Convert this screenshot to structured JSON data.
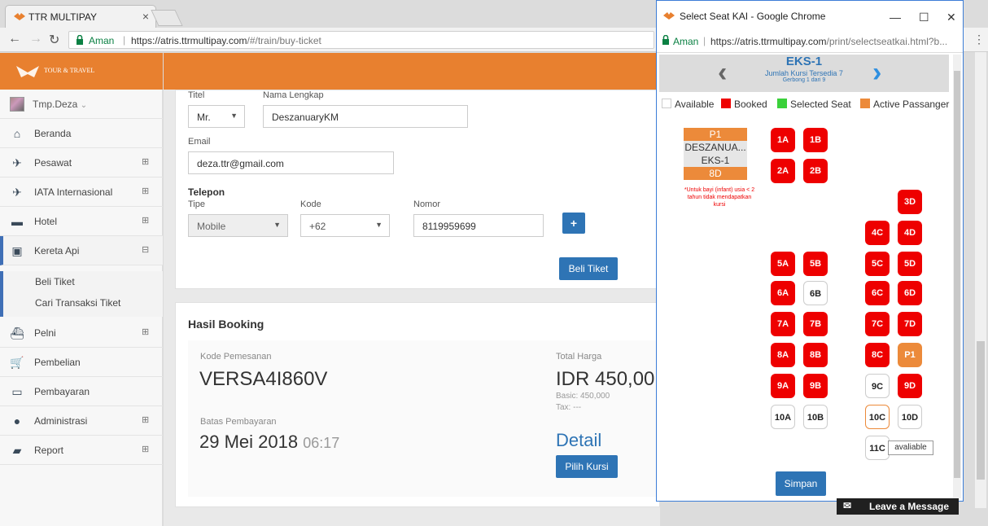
{
  "browser": {
    "tab_title": "TTR MULTIPAY",
    "tab_close": "×",
    "secure_label": "Aman",
    "url_host": "https://atris.ttrmultipay.com",
    "url_path": "/#/train/buy-ticket"
  },
  "sidebar": {
    "logo_text": "TOUR & TRAVEL",
    "user_name": "Tmp.Deza",
    "items": [
      {
        "label": "Beranda",
        "icon": "home-icon"
      },
      {
        "label": "Pesawat",
        "icon": "plane-icon"
      },
      {
        "label": "IATA Internasional",
        "icon": "plane-icon"
      },
      {
        "label": "Hotel",
        "icon": "bed-icon"
      },
      {
        "label": "Kereta Api",
        "icon": "train-icon"
      },
      {
        "label": "Pelni",
        "icon": "ship-icon"
      },
      {
        "label": "Pembelian",
        "icon": "cart-icon"
      },
      {
        "label": "Pembayaran",
        "icon": "money-icon"
      },
      {
        "label": "Administrasi",
        "icon": "user-icon"
      },
      {
        "label": "Report",
        "icon": "folder-icon"
      }
    ],
    "subitems": [
      "Beli Tiket",
      "Cari Transaksi Tiket"
    ]
  },
  "form": {
    "titel_label": "Titel",
    "titel_value": "Mr.",
    "nama_label": "Nama Lengkap",
    "nama_value": "DeszanuaryKM",
    "email_label": "Email",
    "email_value": "deza.ttr@gmail.com",
    "telepon_label": "Telepon",
    "tipe_label": "Tipe",
    "tipe_value": "Mobile",
    "kode_label": "Kode",
    "kode_value": "+62",
    "nomor_label": "Nomor",
    "nomor_value": "8119959699",
    "add_label": "+",
    "beli_label": "Beli Tiket"
  },
  "booking": {
    "heading": "Hasil Booking",
    "kode_label": "Kode Pemesanan",
    "kode_value": "VERSA4I860V",
    "total_label": "Total Harga",
    "total_value": "IDR 450,00",
    "basic": "Basic: 450,000",
    "tax": "Tax: ---",
    "batas_label": "Batas Pembayaran",
    "batas_date": "29 Mei 2018",
    "batas_time": "06:17",
    "detail": "Detail",
    "pilih_label": "Pilih Kursi"
  },
  "popup": {
    "window_title": "Select Seat KAI - Google Chrome",
    "secure_label": "Aman",
    "url_host": "https://atris.ttrmultipay.com",
    "url_path": "/print/selectseatkai.html?b...",
    "coach": "EKS-1",
    "jumlah": "Jumlah Kursi Tersedia 7",
    "gerbong": "Gerbong 1 dari 9",
    "legend": [
      {
        "label": "Available",
        "color": "#ffffff"
      },
      {
        "label": "Booked",
        "color": "#ee0000"
      },
      {
        "label": "Selected Seat",
        "color": "#3ad13a"
      },
      {
        "label": "Active Passanger",
        "color": "#ec8a3a"
      }
    ],
    "passenger": {
      "id": "P1",
      "name": "DESZANUA...",
      "coach": "EKS-1",
      "seat": "8D"
    },
    "note": "*Untuk bayi (infant) usia < 2 tahun tidak mendapatkan kursi",
    "tooltip": "avaliable",
    "save_label": "Simpan",
    "seats": [
      {
        "label": "1A",
        "state": "booked"
      },
      {
        "label": "1B",
        "state": "booked"
      },
      {
        "label": "2A",
        "state": "booked"
      },
      {
        "label": "2B",
        "state": "booked"
      },
      {
        "label": "3D",
        "state": "booked"
      },
      {
        "label": "4C",
        "state": "booked"
      },
      {
        "label": "4D",
        "state": "booked"
      },
      {
        "label": "5A",
        "state": "booked"
      },
      {
        "label": "5B",
        "state": "booked"
      },
      {
        "label": "5C",
        "state": "booked"
      },
      {
        "label": "5D",
        "state": "booked"
      },
      {
        "label": "6A",
        "state": "booked"
      },
      {
        "label": "6B",
        "state": "available"
      },
      {
        "label": "6C",
        "state": "booked"
      },
      {
        "label": "6D",
        "state": "booked"
      },
      {
        "label": "7A",
        "state": "booked"
      },
      {
        "label": "7B",
        "state": "booked"
      },
      {
        "label": "7C",
        "state": "booked"
      },
      {
        "label": "7D",
        "state": "booked"
      },
      {
        "label": "8A",
        "state": "booked"
      },
      {
        "label": "8B",
        "state": "booked"
      },
      {
        "label": "8C",
        "state": "booked"
      },
      {
        "label": "P1",
        "state": "active"
      },
      {
        "label": "9A",
        "state": "booked"
      },
      {
        "label": "9B",
        "state": "booked"
      },
      {
        "label": "9C",
        "state": "available"
      },
      {
        "label": "9D",
        "state": "booked"
      },
      {
        "label": "10A",
        "state": "available"
      },
      {
        "label": "10B",
        "state": "available"
      },
      {
        "label": "10C",
        "state": "hover"
      },
      {
        "label": "10D",
        "state": "available"
      },
      {
        "label": "11C",
        "state": "available"
      }
    ]
  },
  "chat": {
    "label": "Leave a Message"
  }
}
